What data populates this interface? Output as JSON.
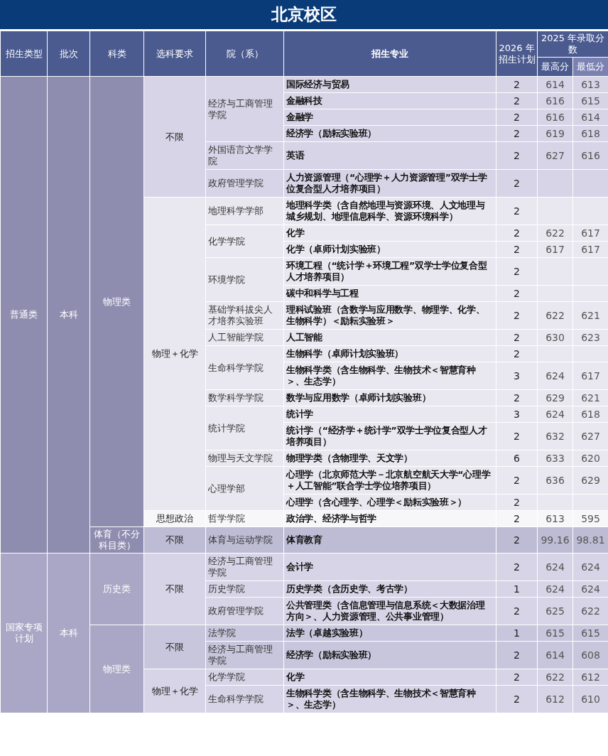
{
  "title": "北京校区",
  "header": {
    "columns": [
      "招生类型",
      "批次",
      "科类",
      "选科要求",
      "院（系）",
      "招生专业",
      "2026 年招生计划"
    ],
    "score_group": {
      "label": "2025 年录取分数",
      "columns": [
        "最高分",
        "最低分"
      ]
    }
  },
  "table": {
    "sections": [
      {
        "type": "普通类",
        "batch": "本科",
        "subjects": [
          {
            "category": "物理类",
            "requirements": [
              {
                "requirement": "不限",
                "colleges": [
                  {
                    "college": "经济与工商管理学院",
                    "majors": [
                      {
                        "name": "国际经济与贸易",
                        "plan": "2",
                        "max": "614",
                        "min": "613"
                      },
                      {
                        "name": "金融科技",
                        "plan": "2",
                        "max": "616",
                        "min": "615"
                      },
                      {
                        "name": "金融学",
                        "plan": "2",
                        "max": "616",
                        "min": "614"
                      },
                      {
                        "name": "经济学（励耘实验班）",
                        "plan": "2",
                        "max": "619",
                        "min": "618"
                      }
                    ]
                  },
                  {
                    "college": "外国语言文学学院",
                    "majors": [
                      {
                        "name": "英语",
                        "plan": "2",
                        "max": "627",
                        "min": "616"
                      }
                    ]
                  },
                  {
                    "college": "政府管理学院",
                    "majors": [
                      {
                        "name": "人力资源管理（“心理学＋人力资源管理”双学士学位复合型人才培养项目）",
                        "plan": "2"
                      }
                    ]
                  }
                ]
              },
              {
                "requirement": "物理＋化学",
                "colleges": [
                  {
                    "college": "地理科学学部",
                    "majors": [
                      {
                        "name": "地理科学类（含自然地理与资源环境、人文地理与城乡规划、地理信息科学、资源环境科学）",
                        "plan": "2"
                      }
                    ]
                  },
                  {
                    "college": "化学学院",
                    "majors": [
                      {
                        "name": "化学",
                        "plan": "2",
                        "max": "622",
                        "min": "617"
                      },
                      {
                        "name": "化学（卓师计划实验班）",
                        "plan": "2",
                        "max": "617",
                        "min": "617"
                      }
                    ]
                  },
                  {
                    "college": "环境学院",
                    "majors": [
                      {
                        "name": "环境工程（“统计学＋环境工程”双学士学位复合型人才培养项目）",
                        "plan": "2"
                      },
                      {
                        "name": "碳中和科学与工程",
                        "plan": "2"
                      }
                    ]
                  },
                  {
                    "college": "基础学科拔尖人才培养实验班",
                    "majors": [
                      {
                        "name": "理科试验班（含数学与应用数学、物理学、化学、生物科学）＜励耘实验班＞",
                        "plan": "2",
                        "max": "622",
                        "min": "621"
                      }
                    ]
                  },
                  {
                    "college": "人工智能学院",
                    "majors": [
                      {
                        "name": "人工智能",
                        "plan": "2",
                        "max": "630",
                        "min": "623"
                      }
                    ]
                  },
                  {
                    "college": "生命科学学院",
                    "majors": [
                      {
                        "name": "生物科学（卓师计划实验班）",
                        "plan": "2"
                      },
                      {
                        "name": "生物科学类（含生物科学、生物技术＜智慧育种＞、生态学）",
                        "plan": "3",
                        "max": "624",
                        "min": "617"
                      }
                    ]
                  },
                  {
                    "college": "数学科学学院",
                    "majors": [
                      {
                        "name": "数学与应用数学（卓师计划实验班）",
                        "plan": "2",
                        "max": "629",
                        "min": "621"
                      }
                    ]
                  },
                  {
                    "college": "统计学院",
                    "majors": [
                      {
                        "name": "统计学",
                        "plan": "3",
                        "max": "624",
                        "min": "618"
                      },
                      {
                        "name": "统计学（“经济学＋统计学”双学士学位复合型人才培养项目）",
                        "plan": "2",
                        "max": "632",
                        "min": "627"
                      }
                    ]
                  },
                  {
                    "college": "物理与天文学院",
                    "majors": [
                      {
                        "name": "物理学类（含物理学、天文学）",
                        "plan": "6",
                        "max": "633",
                        "min": "620"
                      }
                    ]
                  },
                  {
                    "college": "心理学部",
                    "majors": [
                      {
                        "name": "心理学（北京师范大学－北京航空航天大学“心理学＋人工智能”联合学士学位培养项目）",
                        "plan": "2",
                        "max": "636",
                        "min": "629"
                      },
                      {
                        "name": "心理学（含心理学、心理学＜励耘实验班＞）",
                        "plan": "2"
                      }
                    ]
                  }
                ]
              },
              {
                "requirement": "思想政治",
                "colleges": [
                  {
                    "college": "哲学学院",
                    "majors": [
                      {
                        "name": "政治学、经济学与哲学",
                        "plan": "2",
                        "max": "613",
                        "min": "595"
                      }
                    ]
                  }
                ]
              }
            ]
          },
          {
            "category": "体育（不分科目类）",
            "requirements": [
              {
                "requirement": "不限",
                "colleges": [
                  {
                    "college": "体育与运动学院",
                    "majors": [
                      {
                        "name": "体育教育",
                        "plan": "2",
                        "max": "99.16",
                        "min": "98.81"
                      }
                    ]
                  }
                ]
              }
            ]
          }
        ]
      },
      {
        "type": "国家专项计划",
        "batch": "本科",
        "subjects": [
          {
            "category": "历史类",
            "requirements": [
              {
                "requirement": "不限",
                "colleges": [
                  {
                    "college": "经济与工商管理学院",
                    "majors": [
                      {
                        "name": "会计学",
                        "plan": "2",
                        "max": "624",
                        "min": "624"
                      }
                    ]
                  },
                  {
                    "college": "历史学院",
                    "majors": [
                      {
                        "name": "历史学类（含历史学、考古学）",
                        "plan": "1",
                        "max": "624",
                        "min": "624"
                      }
                    ]
                  },
                  {
                    "college": "政府管理学院",
                    "majors": [
                      {
                        "name": "公共管理类（含信息管理与信息系统＜大数据治理方向＞、人力资源管理、公共事业管理）",
                        "plan": "2",
                        "max": "625",
                        "min": "622"
                      }
                    ]
                  }
                ]
              }
            ]
          },
          {
            "category": "物理类",
            "requirements": [
              {
                "requirement": "不限",
                "colleges": [
                  {
                    "college": "法学院",
                    "majors": [
                      {
                        "name": "法学（卓越实验班）",
                        "plan": "1",
                        "max": "615",
                        "min": "615"
                      }
                    ]
                  },
                  {
                    "college": "经济与工商管理学院",
                    "majors": [
                      {
                        "name": "经济学（励耘实验班）",
                        "plan": "2",
                        "max": "614",
                        "min": "608"
                      }
                    ]
                  }
                ]
              },
              {
                "requirement": "物理＋化学",
                "colleges": [
                  {
                    "college": "化学学院",
                    "majors": [
                      {
                        "name": "化学",
                        "plan": "2",
                        "max": "622",
                        "min": "612"
                      }
                    ]
                  },
                  {
                    "college": "生命科学学院",
                    "majors": [
                      {
                        "name": "生物科学类（含生物科学、生物技术＜智慧育种＞、生态学）",
                        "plan": "2",
                        "max": "612",
                        "min": "610"
                      }
                    ]
                  }
                ]
              }
            ]
          }
        ]
      }
    ]
  }
}
